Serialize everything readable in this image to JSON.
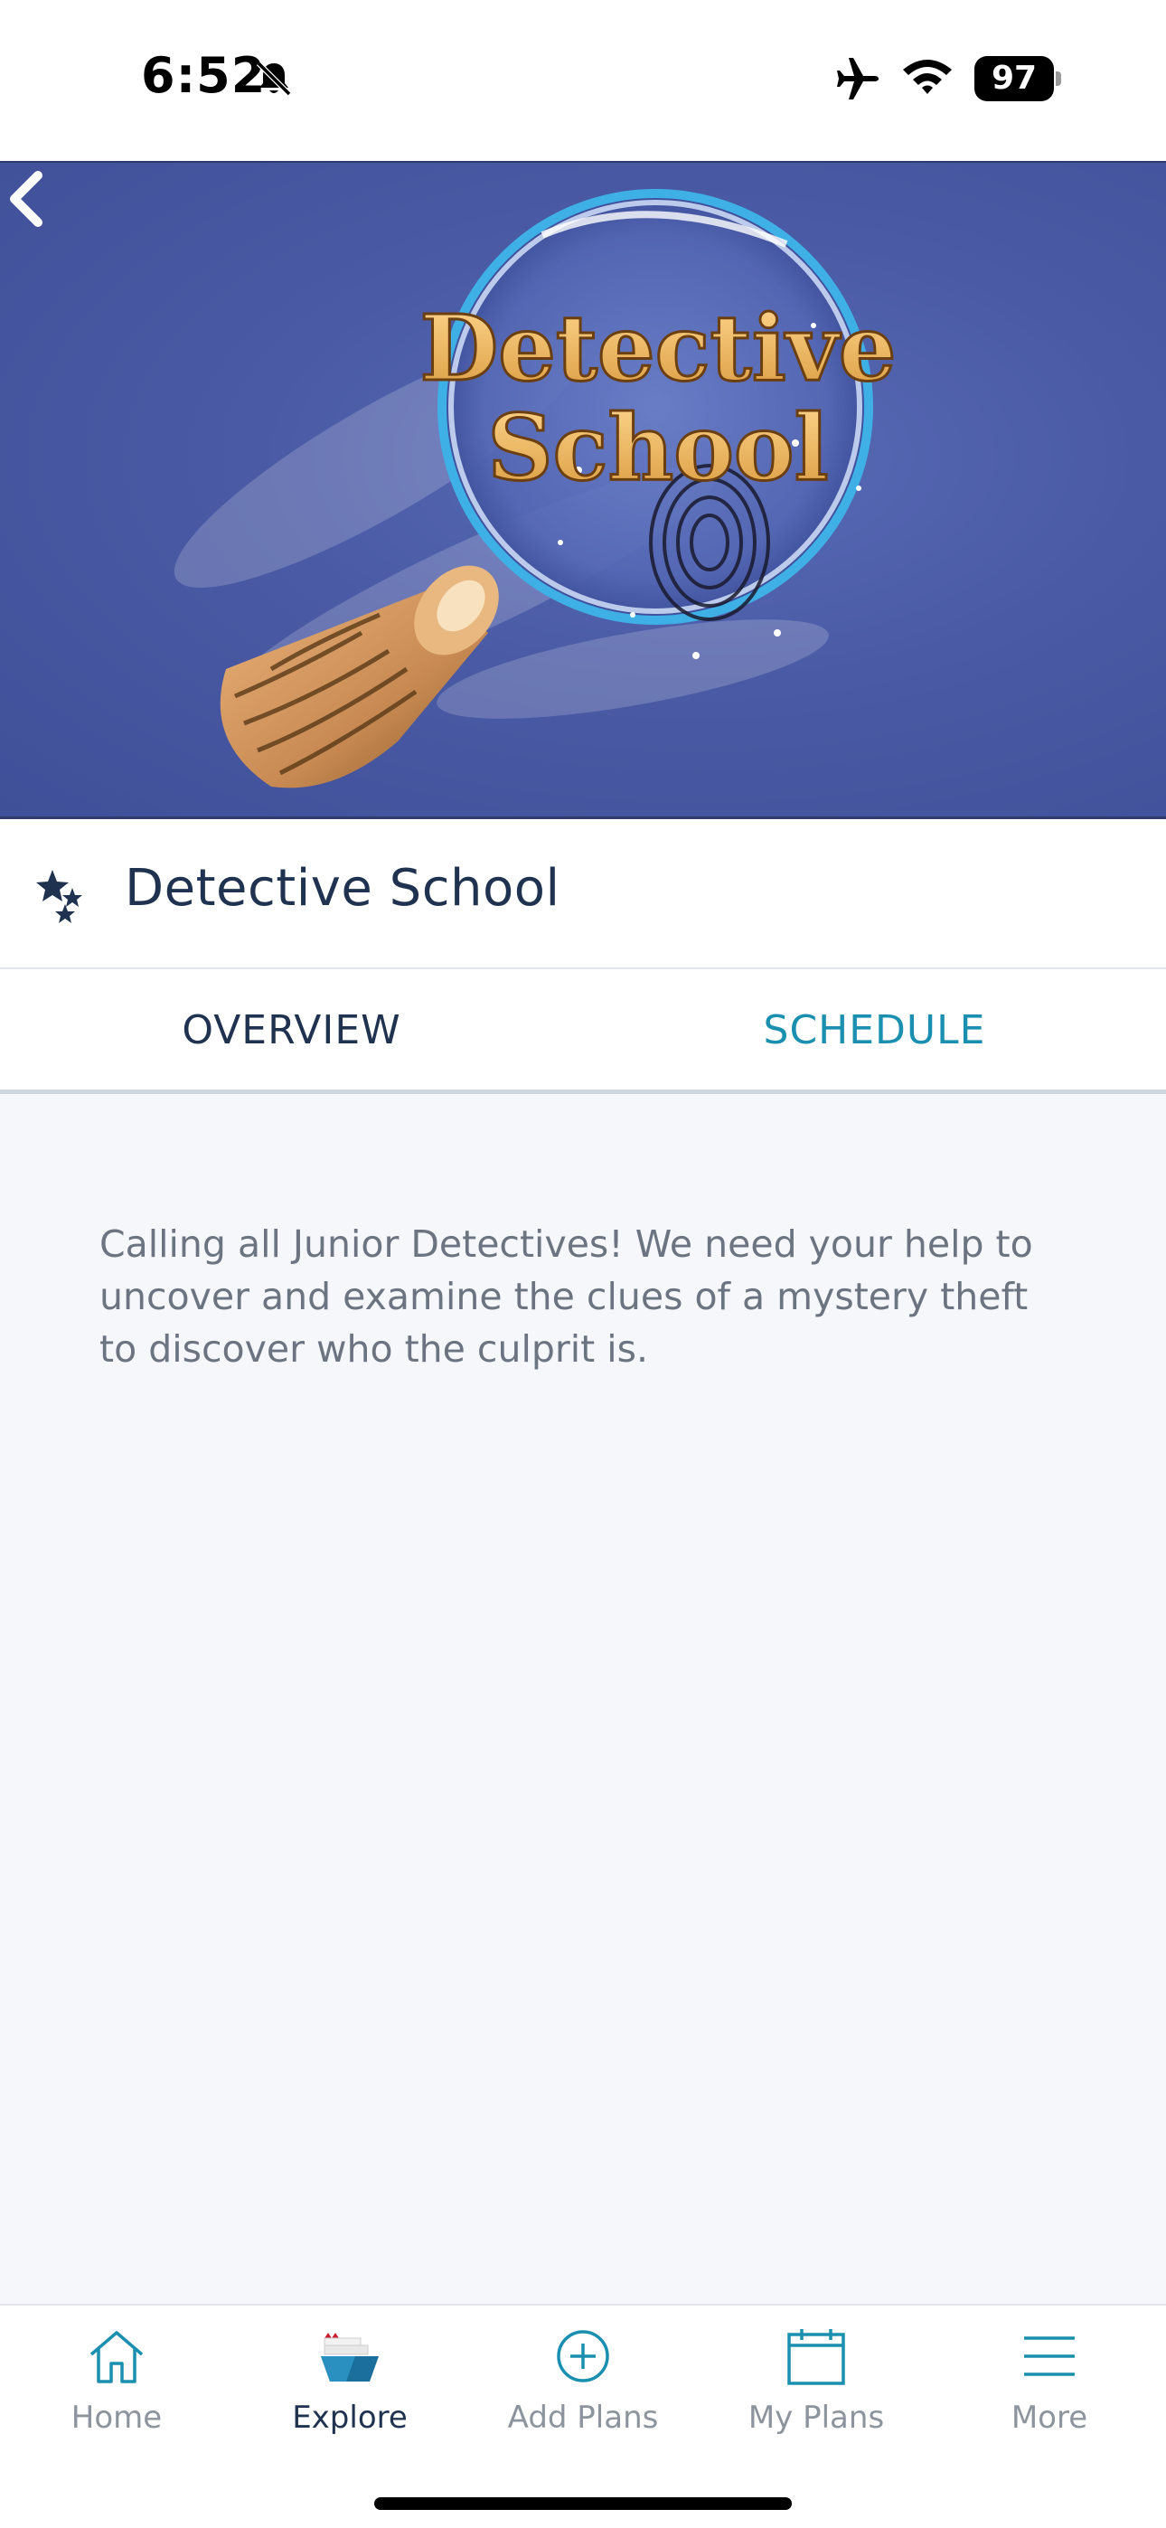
{
  "status_bar": {
    "time": "6:52",
    "battery": "97"
  },
  "hero": {
    "image_title_line1": "Detective",
    "image_title_line2": "School"
  },
  "activity": {
    "title": "Detective School",
    "icon": "stars-icon"
  },
  "tabs": [
    {
      "label": "OVERVIEW",
      "active": false
    },
    {
      "label": "SCHEDULE",
      "active": true
    }
  ],
  "description": "Calling all Junior Detectives! We need your help to uncover and examine the clues of a mystery theft to discover who the culprit is.",
  "nav": {
    "items": [
      {
        "label": "Home",
        "icon": "home-icon",
        "active": false
      },
      {
        "label": "Explore",
        "icon": "ship-icon",
        "active": true
      },
      {
        "label": "Add Plans",
        "icon": "plus-circle-icon",
        "active": false
      },
      {
        "label": "My Plans",
        "icon": "calendar-icon",
        "active": false
      },
      {
        "label": "More",
        "icon": "menu-icon",
        "active": false
      }
    ]
  },
  "colors": {
    "accent": "#1a8fb0",
    "title": "#1f3350",
    "hero_bg": "#4a5aa4"
  }
}
